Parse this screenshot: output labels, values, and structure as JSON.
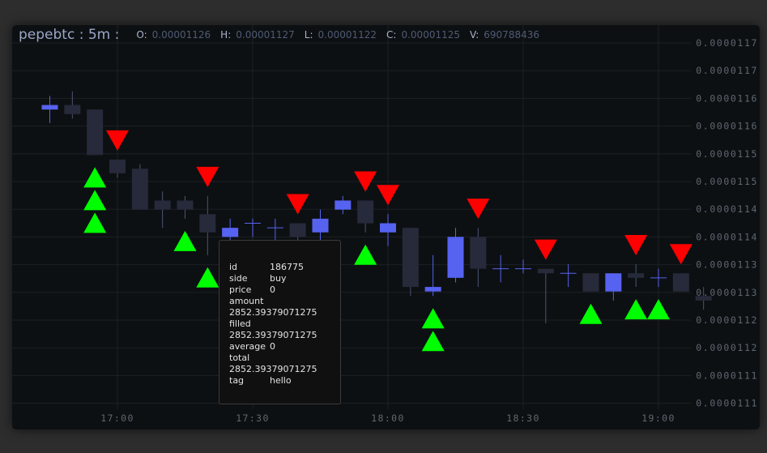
{
  "header": {
    "symbol": "pepebtc : 5m :",
    "o_label": "O:",
    "o_value": "0.00001126",
    "h_label": "H:",
    "h_value": "0.00001127",
    "l_label": "L:",
    "l_value": "0.00001122",
    "c_label": "C:",
    "c_value": "0.00001125",
    "v_label": "V:",
    "v_value": "690788436"
  },
  "colors": {
    "background": "#0d1012",
    "up_candle": "#5662f0",
    "down_candle": "#262a3a",
    "buy_marker": "#00ff00",
    "sell_marker": "#ff0000",
    "grid": "#1c2125",
    "axis_text": "#5f6772"
  },
  "tooltip": {
    "rows": [
      {
        "key": "id",
        "value": "186775"
      },
      {
        "key": "side",
        "value": "buy"
      },
      {
        "key": "price",
        "value": "0"
      },
      {
        "key": "amount",
        "value": "2852.39379071275"
      },
      {
        "key": "filled",
        "value": "2852.39379071275"
      },
      {
        "key": "average",
        "value": "0"
      },
      {
        "key": "total",
        "value": "2852.39379071275"
      },
      {
        "key": "tag",
        "value": "hello"
      }
    ]
  },
  "chart_data": {
    "type": "candlestick",
    "interval": "5m",
    "y_tick_labels": [
      "0.0000117",
      "0.0000117",
      "0.0000116",
      "0.0000116",
      "0.0000115",
      "0.0000115",
      "0.0000114",
      "0.0000114",
      "0.0000113",
      "0.0000113",
      "0.0000112",
      "0.0000112",
      "0.0000111",
      "0.0000111"
    ],
    "x_tick_labels": [
      "17:00",
      "17:30",
      "18:00",
      "18:30",
      "19:00"
    ],
    "ylim": [
      1.1e-05,
      1.17e-05
    ],
    "grid": true,
    "candles": [
      {
        "time": "16:45",
        "open": 1.16e-05,
        "high": 1.163e-05,
        "low": 1.157e-05,
        "close": 1.161e-05
      },
      {
        "time": "16:50",
        "open": 1.161e-05,
        "high": 1.164e-05,
        "low": 1.158e-05,
        "close": 1.159e-05
      },
      {
        "time": "16:55",
        "open": 1.16e-05,
        "high": 1.16e-05,
        "low": 1.15e-05,
        "close": 1.15e-05
      },
      {
        "time": "17:00",
        "open": 1.149e-05,
        "high": 1.149e-05,
        "low": 1.145e-05,
        "close": 1.146e-05
      },
      {
        "time": "17:05",
        "open": 1.147e-05,
        "high": 1.148e-05,
        "low": 1.138e-05,
        "close": 1.138e-05
      },
      {
        "time": "17:10",
        "open": 1.14e-05,
        "high": 1.142e-05,
        "low": 1.134e-05,
        "close": 1.138e-05
      },
      {
        "time": "17:15",
        "open": 1.14e-05,
        "high": 1.141e-05,
        "low": 1.136e-05,
        "close": 1.138e-05
      },
      {
        "time": "17:20",
        "open": 1.137e-05,
        "high": 1.141e-05,
        "low": 1.128e-05,
        "close": 1.133e-05
      },
      {
        "time": "17:25",
        "open": 1.132e-05,
        "high": 1.136e-05,
        "low": 1.13e-05,
        "close": 1.134e-05
      },
      {
        "time": "17:30",
        "open": 1.135e-05,
        "high": 1.136e-05,
        "low": 1.132e-05,
        "close": 1.135e-05
      },
      {
        "time": "17:35",
        "open": 1.134e-05,
        "high": 1.136e-05,
        "low": 1.131e-05,
        "close": 1.134e-05
      },
      {
        "time": "17:40",
        "open": 1.135e-05,
        "high": 1.135e-05,
        "low": 1.13e-05,
        "close": 1.132e-05
      },
      {
        "time": "17:45",
        "open": 1.133e-05,
        "high": 1.138e-05,
        "low": 1.131e-05,
        "close": 1.136e-05
      },
      {
        "time": "17:50",
        "open": 1.138e-05,
        "high": 1.141e-05,
        "low": 1.137e-05,
        "close": 1.14e-05
      },
      {
        "time": "17:55",
        "open": 1.14e-05,
        "high": 1.14e-05,
        "low": 1.133e-05,
        "close": 1.135e-05
      },
      {
        "time": "18:00",
        "open": 1.133e-05,
        "high": 1.137e-05,
        "low": 1.13e-05,
        "close": 1.135e-05
      },
      {
        "time": "18:05",
        "open": 1.134e-05,
        "high": 1.134e-05,
        "low": 1.119e-05,
        "close": 1.121e-05
      },
      {
        "time": "18:10",
        "open": 1.12e-05,
        "high": 1.128e-05,
        "low": 1.119e-05,
        "close": 1.121e-05
      },
      {
        "time": "18:15",
        "open": 1.123e-05,
        "high": 1.134e-05,
        "low": 1.122e-05,
        "close": 1.132e-05
      },
      {
        "time": "18:20",
        "open": 1.132e-05,
        "high": 1.134e-05,
        "low": 1.121e-05,
        "close": 1.125e-05
      },
      {
        "time": "18:25",
        "open": 1.125e-05,
        "high": 1.128e-05,
        "low": 1.122e-05,
        "close": 1.125e-05
      },
      {
        "time": "18:30",
        "open": 1.125e-05,
        "high": 1.127e-05,
        "low": 1.124e-05,
        "close": 1.125e-05
      },
      {
        "time": "18:35",
        "open": 1.125e-05,
        "high": 1.125e-05,
        "low": 1.113e-05,
        "close": 1.124e-05
      },
      {
        "time": "18:40",
        "open": 1.124e-05,
        "high": 1.126e-05,
        "low": 1.121e-05,
        "close": 1.124e-05
      },
      {
        "time": "18:45",
        "open": 1.124e-05,
        "high": 1.124e-05,
        "low": 1.12e-05,
        "close": 1.12e-05
      },
      {
        "time": "18:50",
        "open": 1.12e-05,
        "high": 1.124e-05,
        "low": 1.118e-05,
        "close": 1.124e-05
      },
      {
        "time": "18:55",
        "open": 1.124e-05,
        "high": 1.126e-05,
        "low": 1.121e-05,
        "close": 1.123e-05
      },
      {
        "time": "19:00",
        "open": 1.123e-05,
        "high": 1.125e-05,
        "low": 1.121e-05,
        "close": 1.123e-05
      },
      {
        "time": "19:05",
        "open": 1.124e-05,
        "high": 1.124e-05,
        "low": 1.12e-05,
        "close": 1.12e-05
      },
      {
        "time": "19:10",
        "open": 1.119e-05,
        "high": 1.121e-05,
        "low": 1.116e-05,
        "close": 1.118e-05
      }
    ],
    "buy_markers": [
      {
        "time": "16:55",
        "count": 3
      },
      {
        "time": "17:15",
        "count": 1
      },
      {
        "time": "17:20",
        "count": 1
      },
      {
        "time": "17:40",
        "count": 1
      },
      {
        "time": "17:45",
        "count": 1
      },
      {
        "time": "17:55",
        "count": 1
      },
      {
        "time": "18:10",
        "count": 2
      },
      {
        "time": "18:45",
        "count": 1
      },
      {
        "time": "18:55",
        "count": 1
      },
      {
        "time": "19:00",
        "count": 1
      }
    ],
    "sell_markers": [
      {
        "time": "17:00",
        "count": 1
      },
      {
        "time": "17:20",
        "count": 1
      },
      {
        "time": "17:40",
        "count": 1
      },
      {
        "time": "17:55",
        "count": 1
      },
      {
        "time": "18:00",
        "count": 1
      },
      {
        "time": "18:20",
        "count": 1
      },
      {
        "time": "18:35",
        "count": 1
      },
      {
        "time": "18:55",
        "count": 1
      },
      {
        "time": "19:05",
        "count": 1
      }
    ]
  }
}
